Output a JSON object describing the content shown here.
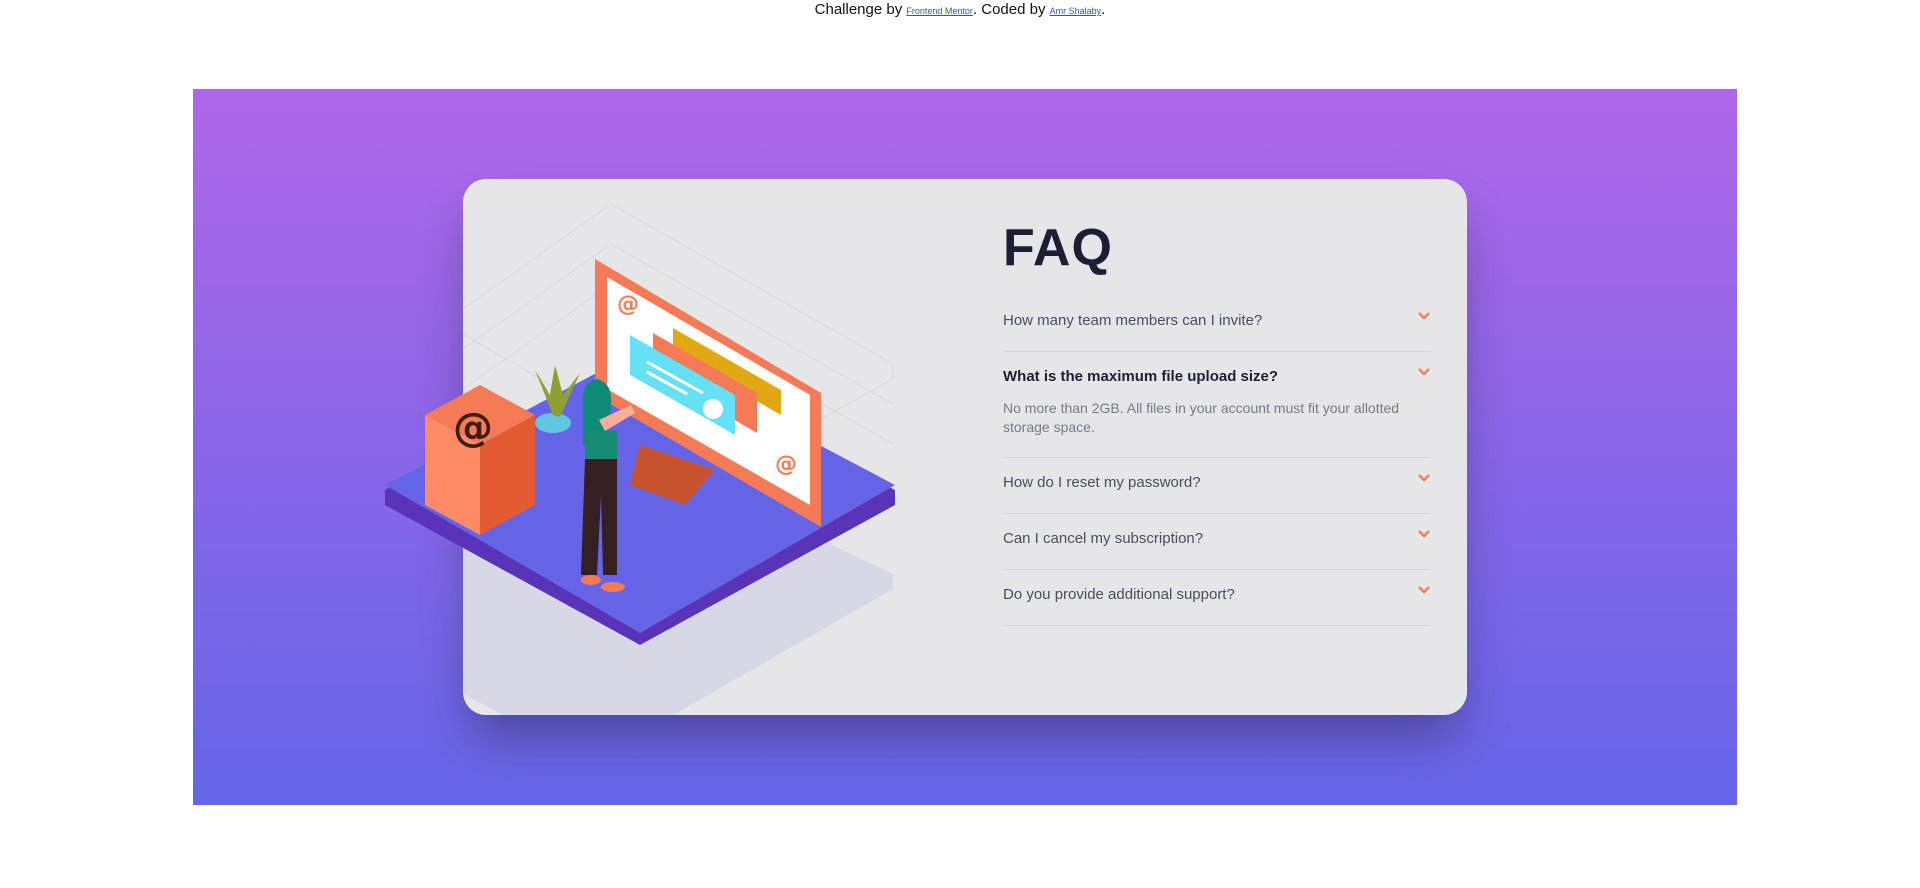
{
  "attribution": {
    "prefix": "Challenge by",
    "challenge_link": "Frontend Mentor",
    "middle": ". Coded by",
    "author_link": "Amr Shalaby",
    "suffix": "."
  },
  "colors": {
    "gradient_top": "#af67e9",
    "gradient_bottom": "#6565e7",
    "card_bg": "#e6e6e9",
    "accent": "#f47b56",
    "heading": "#1d1e35"
  },
  "faq": {
    "title": "FAQ",
    "items": [
      {
        "question": "How many team members can I invite?",
        "answer": "",
        "open": false
      },
      {
        "question": "What is the maximum file upload size?",
        "answer": "No more than 2GB. All files in your account must fit your allotted storage space.",
        "open": true
      },
      {
        "question": "How do I reset my password?",
        "answer": "",
        "open": false
      },
      {
        "question": "Can I cancel my subscription?",
        "answer": "",
        "open": false
      },
      {
        "question": "Do you provide additional support?",
        "answer": "",
        "open": false
      }
    ],
    "toggle_icon": "chevron-down-icon"
  },
  "illustration": {
    "icon": "woman-online-illustration",
    "box_icon": "at-sign-box-icon"
  }
}
